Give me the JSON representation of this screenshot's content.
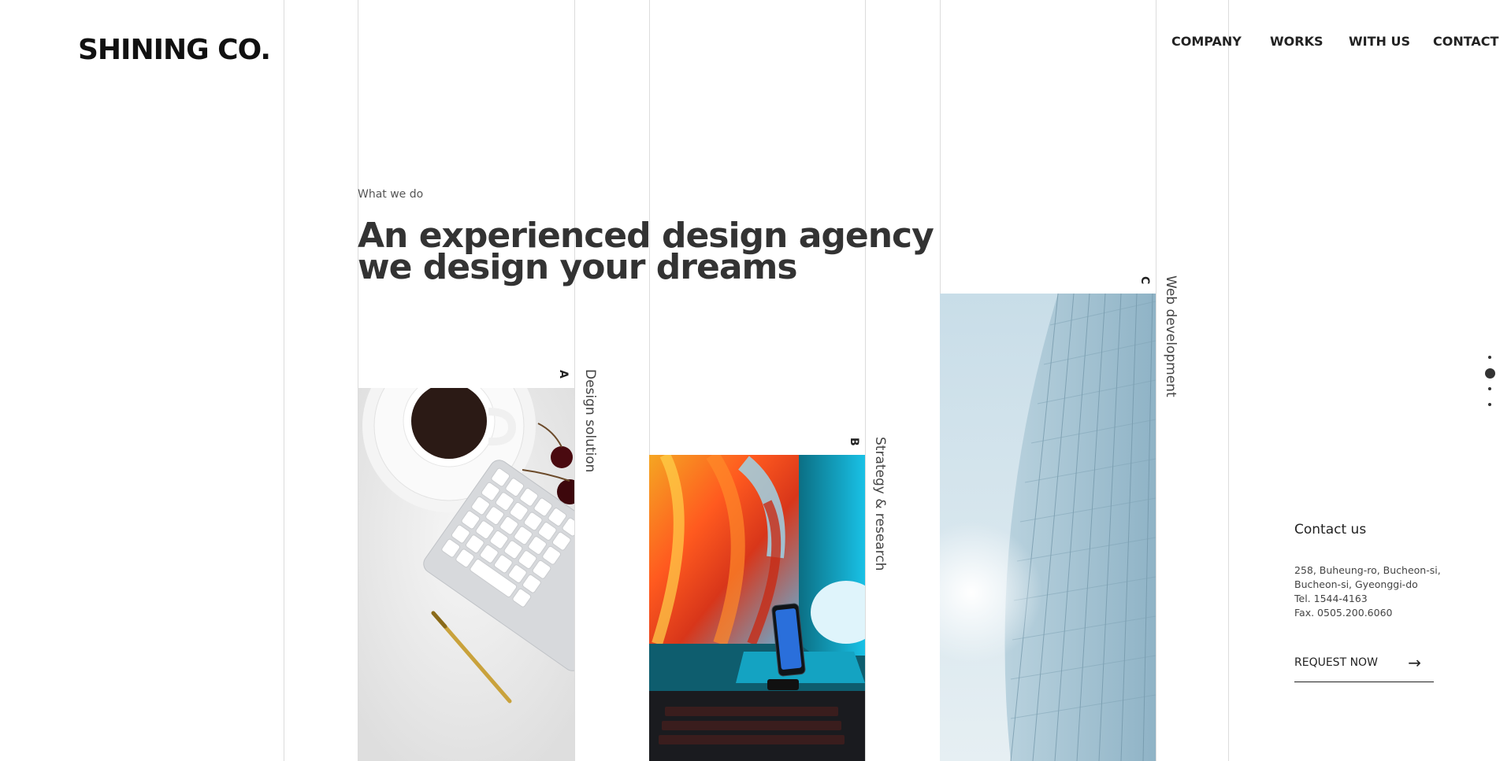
{
  "brand": {
    "logo": "SHINING CO."
  },
  "nav": {
    "items": [
      "COMPANY",
      "WORKS",
      "WITH US",
      "CONTACT"
    ]
  },
  "hero": {
    "eyebrow": "What we do",
    "headline_line1": "An experienced design agency",
    "headline_line2": "we design your dreams"
  },
  "services": [
    {
      "letter": "A",
      "label": "Design solution",
      "image": "coffee-keyboard-photo"
    },
    {
      "letter": "B",
      "label": "Strategy & research",
      "image": "monitor-phone-photo"
    },
    {
      "letter": "C",
      "label": "Web development",
      "image": "glass-building-photo"
    }
  ],
  "pager": {
    "count": 4,
    "active_index": 1
  },
  "contact": {
    "title": "Contact us",
    "address_line1": "258, Buheung-ro, Bucheon-si,",
    "address_line2": "Bucheon-si, Gyeonggi-do",
    "tel": "Tel. 1544-4163",
    "fax": "Fax. 0505.200.6060",
    "cta": "REQUEST NOW"
  },
  "colors": {
    "text": "#2c2c2c",
    "lines": "#dcdcdc",
    "background": "#ffffff"
  }
}
